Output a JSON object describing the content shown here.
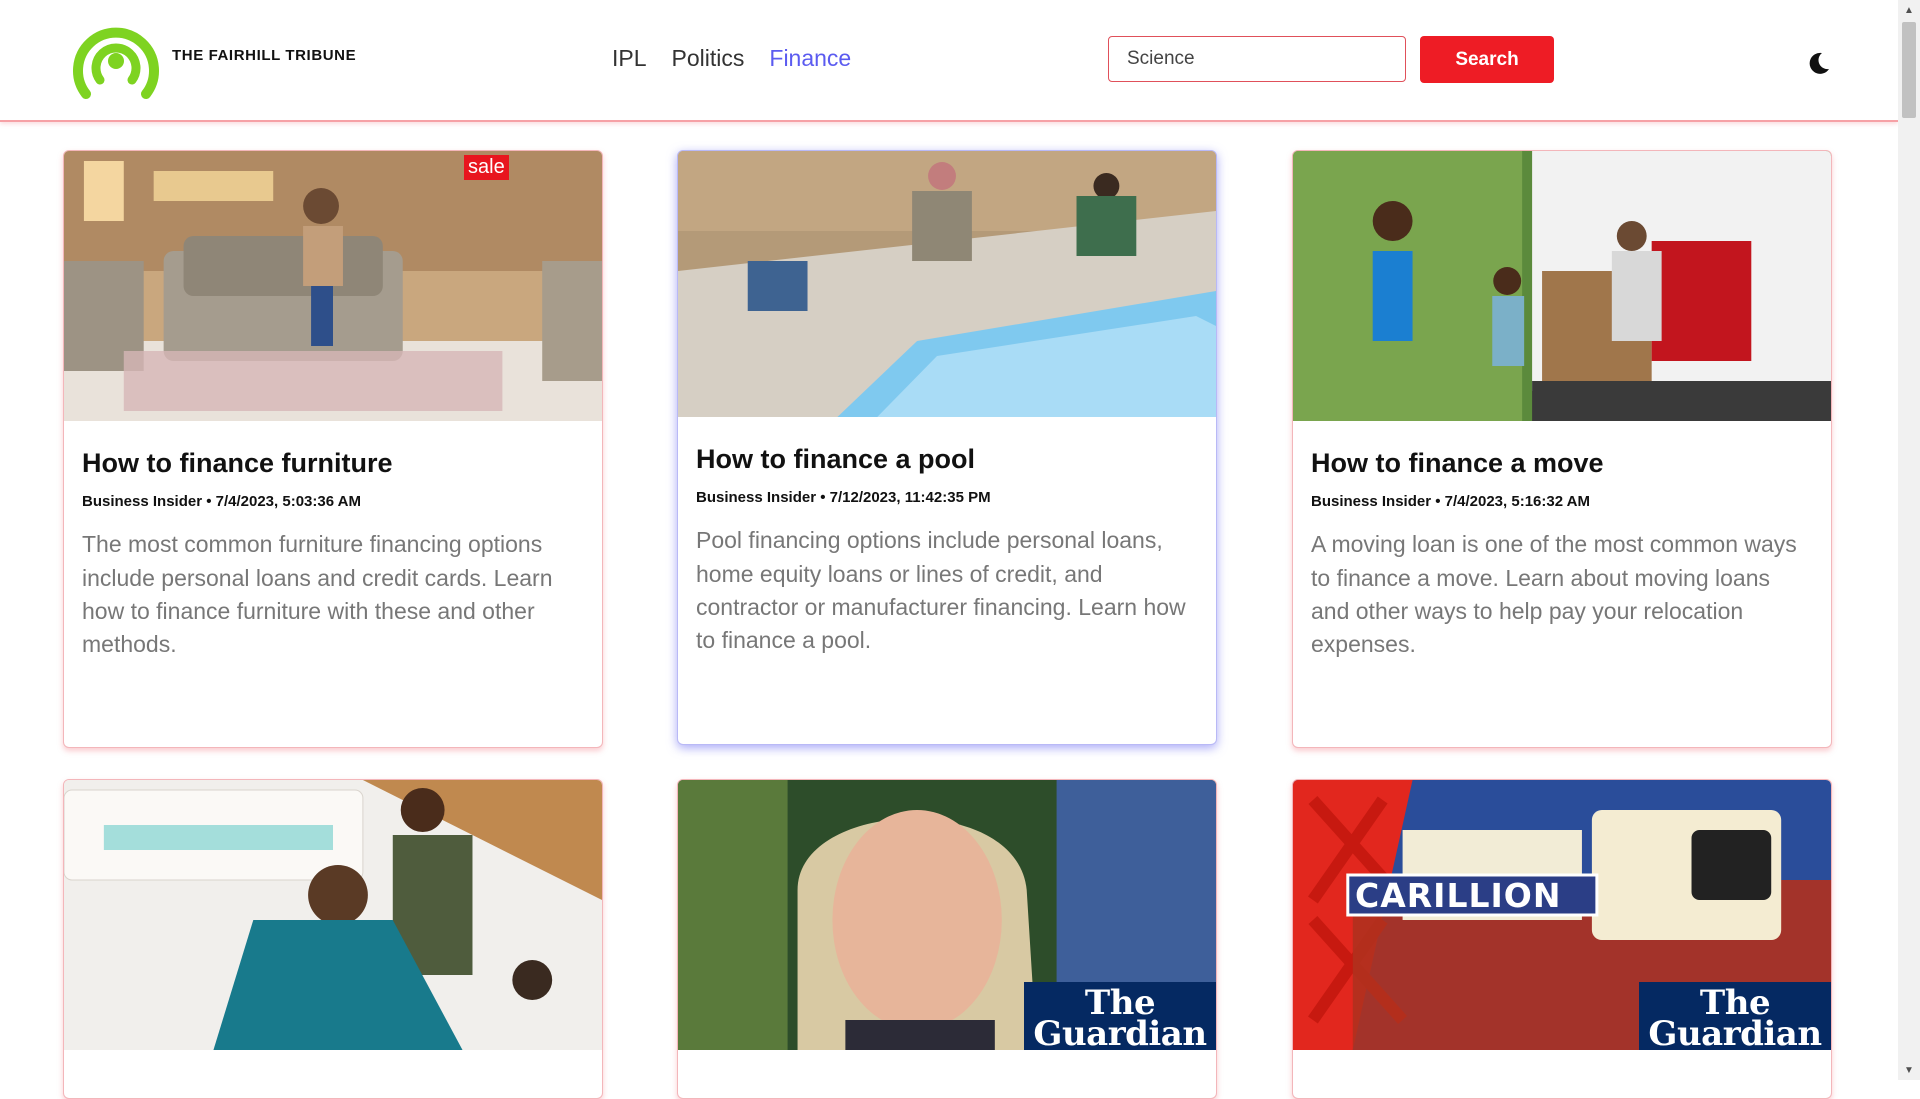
{
  "header": {
    "brand": "THE FAIRHILL TRIBUNE",
    "nav": [
      "IPL",
      "Politics",
      "Finance"
    ],
    "active_nav": "Finance",
    "search": {
      "placeholder": "Science",
      "button_label": "Search"
    }
  },
  "colors": {
    "accent_red": "#ee1c25",
    "active_link": "#5b5bf0",
    "logo_green": "#7ed321",
    "guardian_blue": "#052962"
  },
  "articles": [
    {
      "title": "How to finance furniture",
      "meta": "Business Insider • 7/4/2023, 5:03:36 AM",
      "description": "The most common furniture financing options include personal loans and credit cards. Learn how to finance furniture with these and other methods.",
      "image_text": "sale"
    },
    {
      "title": "How to finance a pool",
      "meta": "Business Insider • 7/12/2023, 11:42:35 PM",
      "description": "Pool financing options include personal loans, home equity loans or lines of credit, and contractor or manufacturer financing. Learn how to finance a pool."
    },
    {
      "title": "How to finance a move",
      "meta": "Business Insider • 7/4/2023, 5:16:32 AM",
      "description": "A moving loan is one of the most common ways to finance a move. Learn about moving loans and other ways to help pay your relocation expenses."
    },
    {
      "title": "",
      "meta": "",
      "description": ""
    },
    {
      "title": "",
      "meta": "",
      "description": "",
      "watermark": [
        "The",
        "Guardian"
      ]
    },
    {
      "title": "",
      "meta": "",
      "description": "",
      "image_text": "CARILLION",
      "watermark": [
        "The",
        "Guardian"
      ]
    }
  ],
  "icons": {
    "logo": "broadcast-signal-icon",
    "theme_toggle": "moon-icon"
  }
}
